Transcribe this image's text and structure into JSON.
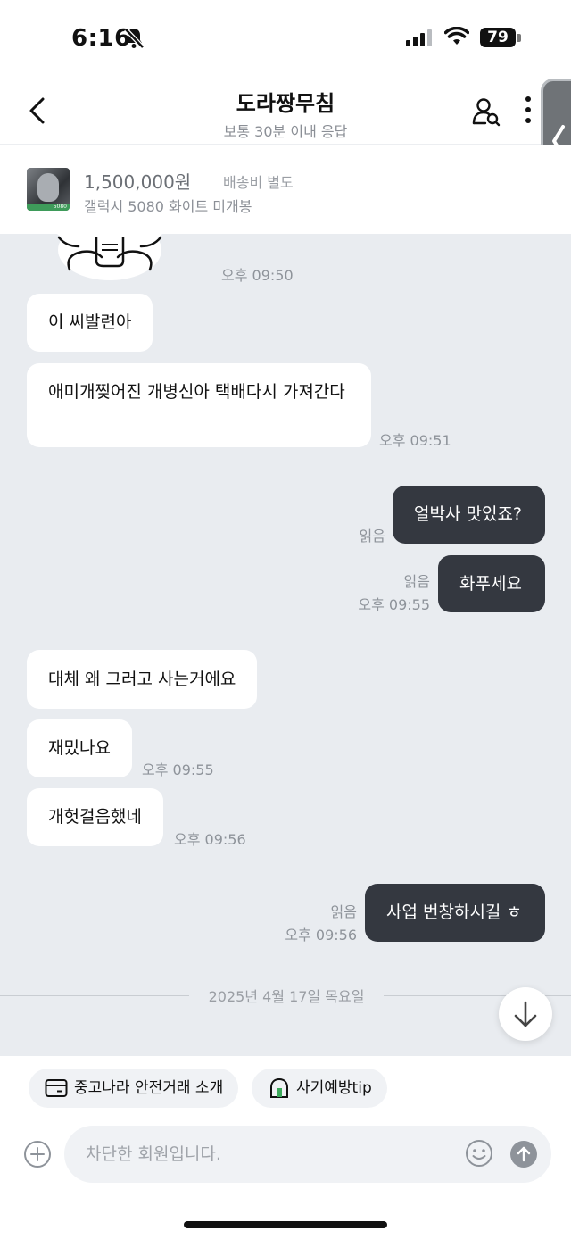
{
  "status_bar": {
    "time": "6:16",
    "battery": "79"
  },
  "header": {
    "title": "도라짱무침",
    "subtitle": "보통 30분 이내 응답"
  },
  "product": {
    "price": "1,500,000원",
    "shipping": "배송비 별도",
    "name": "갤럭시 5080 화이트 미개봉",
    "thumb_tag": "5080"
  },
  "messages": [
    {
      "side": "meta",
      "time": "오후 09:50"
    },
    {
      "side": "them",
      "text": "이 씨발련아"
    },
    {
      "side": "them",
      "text": "애미개찢어진 개병신아 택배다시 가져간다",
      "time": "오후 09:51"
    },
    {
      "side": "me",
      "text": "얼박사 맛있죠?",
      "read": "읽음"
    },
    {
      "side": "me",
      "text": "화푸세요",
      "read": "읽음",
      "time": "오후 09:55"
    },
    {
      "side": "them",
      "text": "대체 왜 그러고 사는거에요"
    },
    {
      "side": "them",
      "text": "재밌나요",
      "time": "오후 09:55"
    },
    {
      "side": "them",
      "text": "개헛걸음했네",
      "time": "오후 09:56"
    },
    {
      "side": "me",
      "text": "사업 번창하시길 ㅎ",
      "read": "읽음",
      "time": "오후 09:56"
    }
  ],
  "date_separator": "2025년 4월 17일 목요일",
  "chips": {
    "safe_trade": "중고나라 안전거래 소개",
    "fraud_tip": "사기예방tip"
  },
  "composer": {
    "placeholder": "차단한 회원입니다."
  },
  "colors": {
    "background": "#e9ecf0",
    "my_bubble": "#343840",
    "their_bubble": "#ffffff",
    "meta_text": "#8e939a"
  }
}
